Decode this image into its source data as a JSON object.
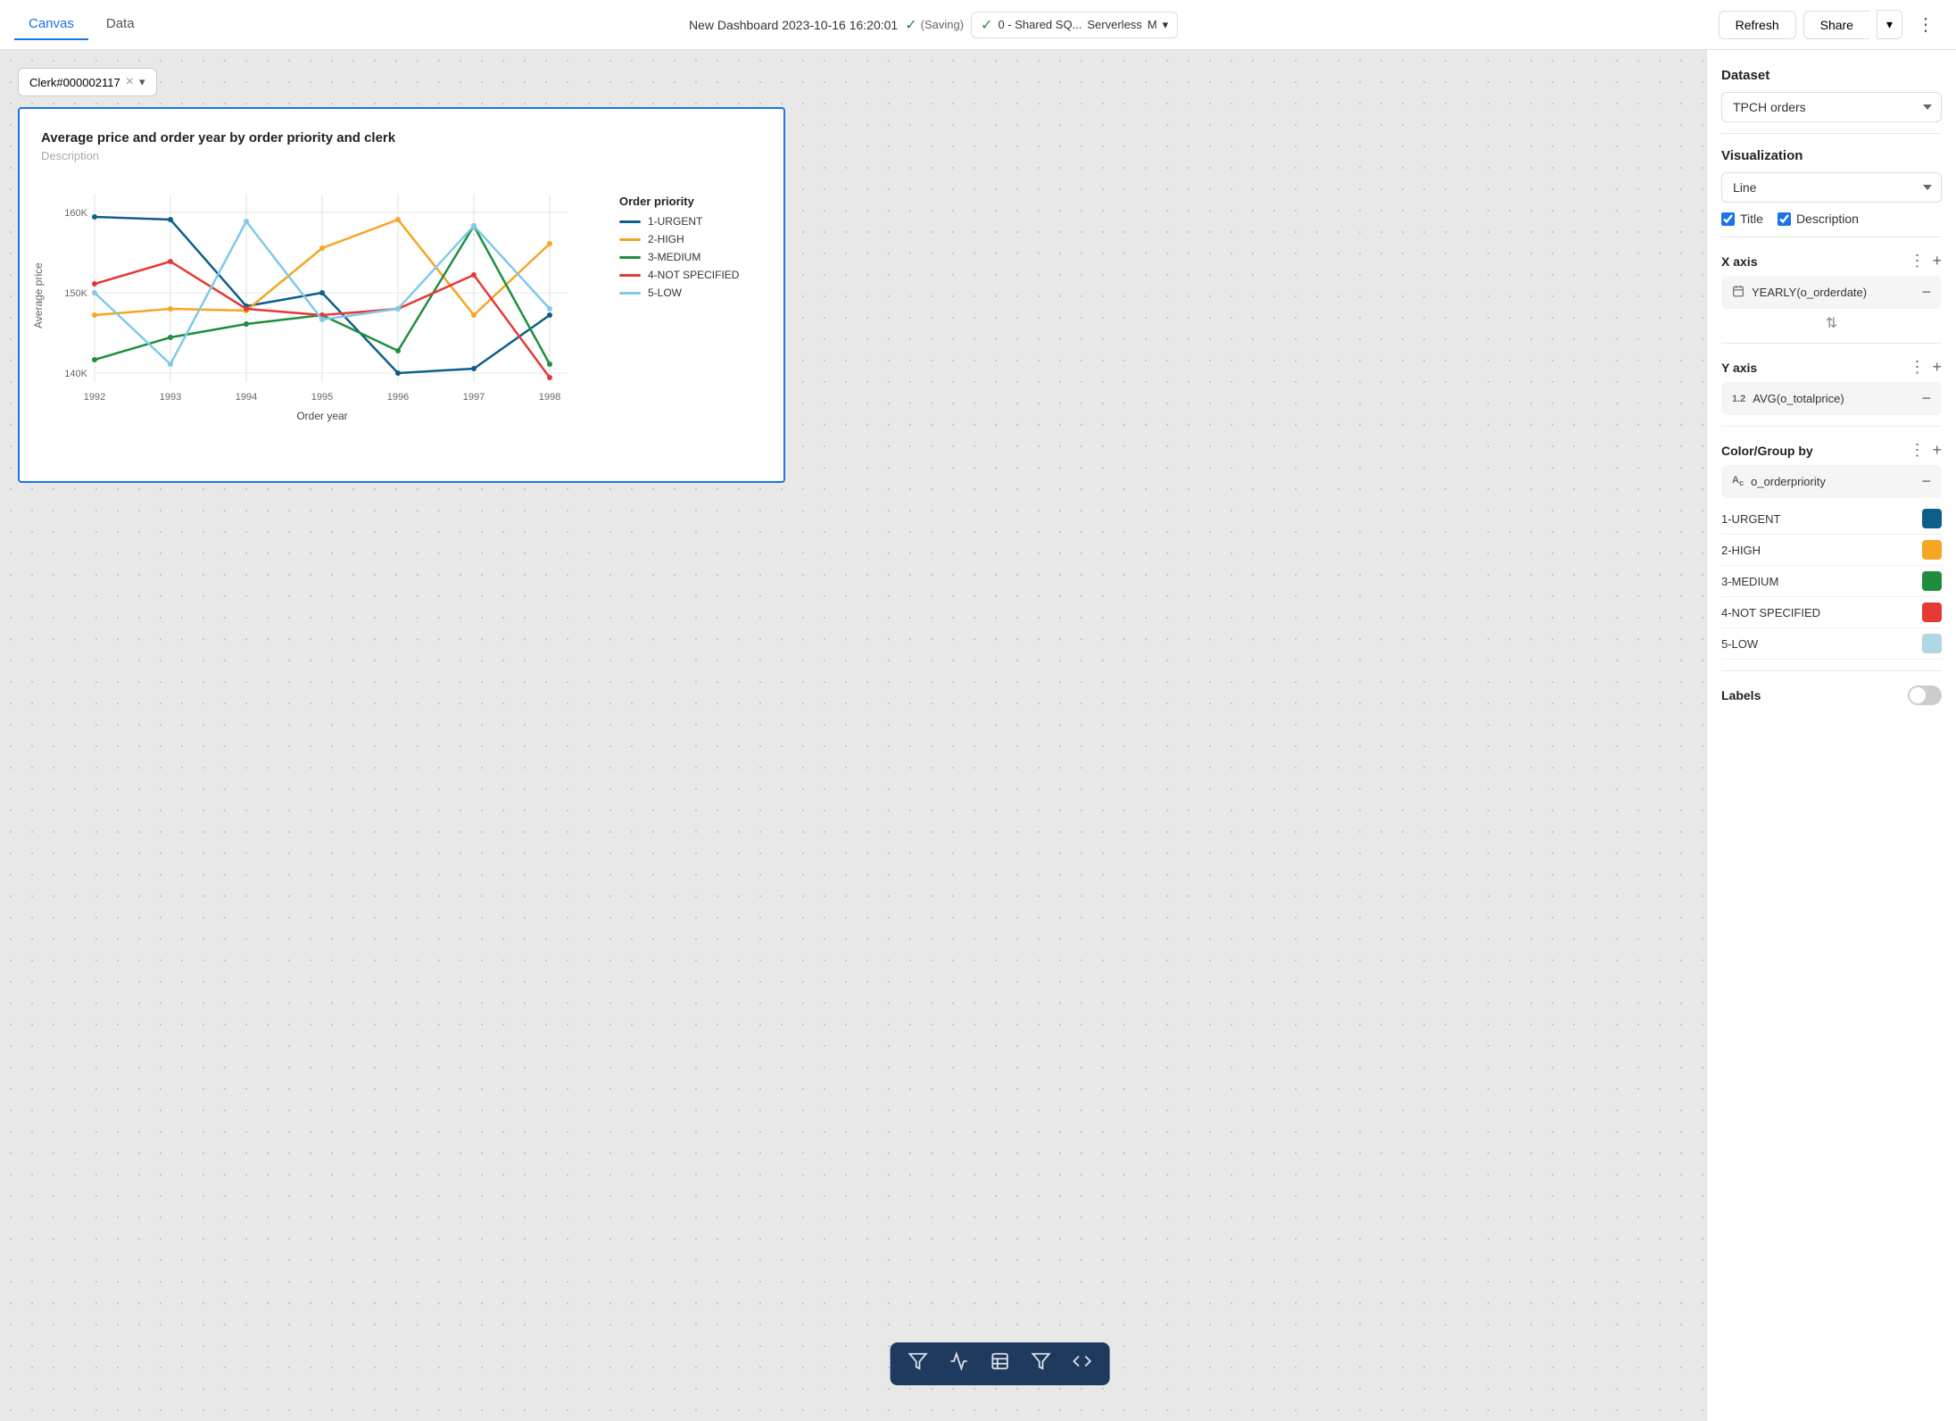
{
  "header": {
    "tab_canvas": "Canvas",
    "tab_data": "Data",
    "dashboard_title": "New Dashboard 2023-10-16 16:20:01",
    "saving_label": "(Saving)",
    "connection_status_icon": "✓",
    "connection_name": "0 - Shared SQ...",
    "connection_type": "Serverless",
    "connection_size": "M",
    "refresh_label": "Refresh",
    "share_label": "Share",
    "more_icon": "⋮"
  },
  "filter": {
    "value": "Clerk#000002117",
    "clear_icon": "×",
    "caret_icon": "▾"
  },
  "chart": {
    "title": "Average price and order year by order priority and clerk",
    "description": "Description",
    "y_axis_label": "Average price",
    "x_axis_label": "Order year",
    "x_ticks": [
      "1992",
      "1993",
      "1994",
      "1995",
      "1996",
      "1997",
      "1998"
    ],
    "y_ticks": [
      "160K",
      "",
      "140K"
    ],
    "legend_title": "Order priority",
    "legend_items": [
      {
        "label": "1-URGENT",
        "color": "#0d5f8a"
      },
      {
        "label": "2-HIGH",
        "color": "#f5a623"
      },
      {
        "label": "3-MEDIUM",
        "color": "#1e8e3e"
      },
      {
        "label": "4-NOT SPECIFIED",
        "color": "#e53935"
      },
      {
        "label": "5-LOW",
        "color": "#80c9e8"
      }
    ]
  },
  "right_panel": {
    "dataset_label": "Dataset",
    "dataset_value": "TPCH orders",
    "visualization_label": "Visualization",
    "visualization_value": "Line",
    "title_checkbox_label": "Title",
    "description_checkbox_label": "Description",
    "x_axis_label": "X axis",
    "x_axis_field": "YEARLY(o_orderdate)",
    "y_axis_label": "Y axis",
    "y_axis_field": "AVG(o_totalprice)",
    "color_group_label": "Color/Group by",
    "color_group_field": "o_orderpriority",
    "color_items": [
      {
        "label": "1-URGENT",
        "color": "#0d5f8a"
      },
      {
        "label": "2-HIGH",
        "color": "#f5a623"
      },
      {
        "label": "3-MEDIUM",
        "color": "#1e8e3e"
      },
      {
        "label": "4-NOT SPECIFIED",
        "color": "#e53935"
      },
      {
        "label": "5-LOW",
        "color": "#add8e6"
      }
    ],
    "labels_label": "Labels"
  },
  "toolbar": {
    "icons": [
      "filter",
      "chart",
      "table",
      "funnel",
      "code"
    ]
  }
}
